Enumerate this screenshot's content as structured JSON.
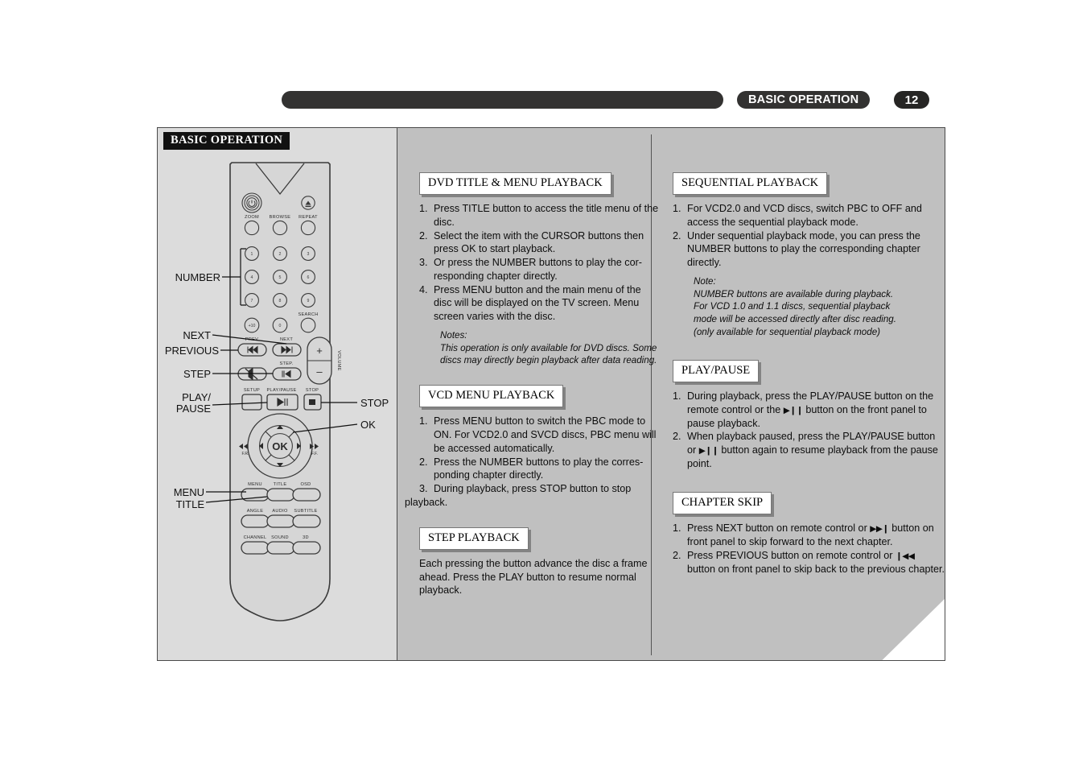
{
  "header": {
    "title": "BASIC OPERATION",
    "page_number": "12"
  },
  "panel": {
    "tag": "BASIC OPERATION"
  },
  "remote": {
    "callouts": [
      {
        "name": "number",
        "label": "NUMBER"
      },
      {
        "name": "next",
        "label": "NEXT"
      },
      {
        "name": "previous",
        "label": "PREVIOUS"
      },
      {
        "name": "step",
        "label": "STEP"
      },
      {
        "name": "play-pause-1",
        "label": "PLAY/"
      },
      {
        "name": "play-pause-2",
        "label": "PAUSE"
      },
      {
        "name": "menu",
        "label": "MENU"
      },
      {
        "name": "title",
        "label": "TITLE"
      },
      {
        "name": "stop",
        "label": "STOP"
      },
      {
        "name": "ok",
        "label": "OK"
      }
    ],
    "buttons": {
      "row_top": [
        "ZOOM",
        "BROWSE",
        "REPEAT"
      ],
      "numbers": [
        "1",
        "2",
        "3",
        "4",
        "5",
        "6",
        "7",
        "8",
        "9"
      ],
      "number_extra": [
        "+10",
        "0"
      ],
      "search": "SEARCH",
      "prev": "PREV",
      "next": "NEXT",
      "step": "STEP.",
      "volume": "VOLUME",
      "volume_plus": "+",
      "volume_minus": "–",
      "setup": "SETUP",
      "play_pause": "PLAY/PAUSE",
      "stop": "STOP",
      "ok": "OK",
      "fast_rewind": "F.R.",
      "fast_forward": "F.F.",
      "row_menu": [
        "MENU",
        "TITLE",
        "OSD"
      ],
      "row_angle": [
        "ANGLE",
        "AUDIO",
        "SUBTITLE"
      ],
      "row_channel": [
        "CHANNEL",
        "SOUND",
        "3D"
      ]
    }
  },
  "sections": {
    "dvd_title_menu": {
      "heading": "DVD TITLE & MENU PLAYBACK",
      "steps": [
        {
          "num": "1.",
          "text": "Press TITLE button to access the title menu of the disc."
        },
        {
          "num": "2.",
          "text": "Select the item with the CURSOR buttons then press OK to start playback."
        },
        {
          "num": "3.",
          "text": "Or press the NUMBER buttons to play the cor-responding chapter directly."
        },
        {
          "num": "4.",
          "text": "Press MENU button and the main menu of the disc will be displayed on the TV screen. Menu screen varies with the disc."
        }
      ],
      "note_label": "Notes:",
      "note_text": "This operation is only available for DVD discs. Some discs may directly begin playback after data reading."
    },
    "vcd_menu": {
      "heading": "VCD MENU PLAYBACK",
      "steps": [
        {
          "num": "1.",
          "text": "Press MENU button to switch the PBC mode to ON. For VCD2.0 and SVCD discs, PBC menu will be accessed automatically."
        },
        {
          "num": "2.",
          "text": "Press the NUMBER buttons to play the corres-ponding chapter directly."
        },
        {
          "num": "3.",
          "text": "During playback, press STOP button to stop"
        }
      ],
      "step3_wrap": "playback."
    },
    "step_playback": {
      "heading": "STEP PLAYBACK",
      "body": "Each pressing the button advance the disc a frame ahead. Press the PLAY button to resume normal playback."
    },
    "sequential_playback": {
      "heading": "SEQUENTIAL PLAYBACK",
      "steps": [
        {
          "num": "1.",
          "text": "For VCD2.0 and VCD discs, switch PBC to OFF and access the sequential playback mode."
        },
        {
          "num": "2.",
          "text": "Under sequential playback mode, you can press the NUMBER buttons to play the corresponding chapter directly."
        }
      ],
      "note_label": "Note:",
      "note_lines": [
        "NUMBER buttons are available during playback.",
        "For VCD 1.0 and 1.1 discs, sequential playback",
        "mode will be accessed directly after disc reading.",
        "(only available for sequential playback mode)"
      ]
    },
    "play_pause": {
      "heading": "PLAY/PAUSE",
      "step1_a": "During playback, press the PLAY/PAUSE button on the remote control  or the",
      "step1_b": "button  on the front  panel to pause playback.",
      "step1_num": "1.",
      "step2_num": "2.",
      "step2_a": "When playback paused, press the PLAY/PAUSE button or",
      "step2_b": "button  again to resume  playback from the  pause point."
    },
    "chapter_skip": {
      "heading": "CHAPTER SKIP",
      "step1_num": "1.",
      "step1_a": "Press NEXT button on remote control or",
      "step1_b": "button on front panel to skip forward to the next chapter.",
      "step2_num": "2.",
      "step2_a": "Press PREVIOUS button on remote control or",
      "step2_b": "button on front panel to skip back to the previous chapter."
    }
  },
  "glyphs": {
    "play_pause": "▶❙❙",
    "next_skip": "▶▶❙",
    "prev_skip": "❙◀◀"
  },
  "colors": {
    "header_dark": "#333231",
    "left_panel_bg": "#dcdcdc",
    "right_panel_bg": "#c0c0c0",
    "text": "#0d0d0d"
  }
}
